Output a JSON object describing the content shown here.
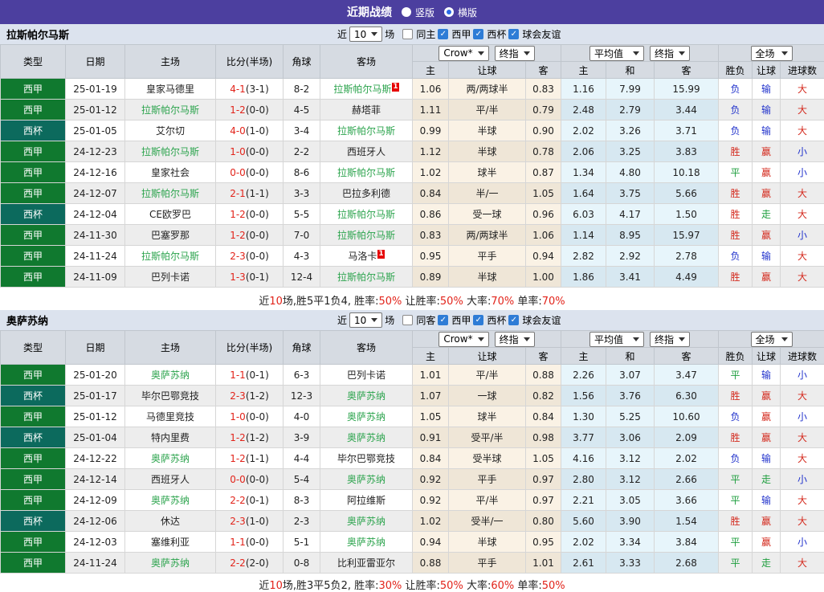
{
  "topbar": {
    "title": "近期战绩",
    "radio_vertical": "竖版",
    "radio_horizontal": "横版",
    "selected_mode": "横版"
  },
  "filters_common": {
    "near_label": "近",
    "near_value": "10",
    "games_label": "场",
    "league1": "西甲",
    "league2": "西杯",
    "league3": "球会友谊"
  },
  "table_header": {
    "type": "类型",
    "date": "日期",
    "home": "主场",
    "score": "比分(半场)",
    "corner": "角球",
    "away": "客场",
    "dd_crow": "Crow*",
    "dd_final1": "终指",
    "dd_avg": "平均值",
    "dd_final2": "终指",
    "dd_full": "全场",
    "h_home": "主",
    "h_handicap": "让球",
    "h_away": "客",
    "a_home": "主",
    "a_draw": "和",
    "a_away": "客",
    "r_wdl": "胜负",
    "r_handicap": "让球",
    "r_goals": "进球数"
  },
  "colors": {
    "topbar_purple": "#4c3f9f",
    "liga_green": "#10792f",
    "cup_teal": "#0c6a5d",
    "self_team_green": "#2da44e",
    "score_red": "#e2241b",
    "win_red": "#d42a1e",
    "lose_blue": "#2233cc",
    "draw_green": "#1e9e3e"
  },
  "sections": [
    {
      "team": "拉斯帕尔马斯",
      "same_label": "同主",
      "rows": [
        {
          "league": "西甲",
          "date": "25-01-19",
          "home": {
            "name": "皇家马德里",
            "self": false,
            "red": 0
          },
          "score_ft": "4-1",
          "score_ht": "(3-1)",
          "corner": "8-2",
          "away": {
            "name": "拉斯帕尔马斯",
            "self": true,
            "red": 1
          },
          "odds": [
            "1.06",
            "两/两球半",
            "0.83",
            "1.16",
            "7.99",
            "15.99"
          ],
          "results": [
            "负",
            "输",
            "大"
          ]
        },
        {
          "league": "西甲",
          "date": "25-01-12",
          "home": {
            "name": "拉斯帕尔马斯",
            "self": true,
            "red": 0
          },
          "score_ft": "1-2",
          "score_ht": "(0-0)",
          "corner": "4-5",
          "away": {
            "name": "赫塔菲",
            "self": false,
            "red": 0
          },
          "odds": [
            "1.11",
            "平/半",
            "0.79",
            "2.48",
            "2.79",
            "3.44"
          ],
          "results": [
            "负",
            "输",
            "大"
          ]
        },
        {
          "league": "西杯",
          "date": "25-01-05",
          "home": {
            "name": "艾尔切",
            "self": false,
            "red": 0
          },
          "score_ft": "4-0",
          "score_ht": "(1-0)",
          "corner": "3-4",
          "away": {
            "name": "拉斯帕尔马斯",
            "self": true,
            "red": 0
          },
          "odds": [
            "0.99",
            "半球",
            "0.90",
            "2.02",
            "3.26",
            "3.71"
          ],
          "results": [
            "负",
            "输",
            "大"
          ]
        },
        {
          "league": "西甲",
          "date": "24-12-23",
          "home": {
            "name": "拉斯帕尔马斯",
            "self": true,
            "red": 0
          },
          "score_ft": "1-0",
          "score_ht": "(0-0)",
          "corner": "2-2",
          "away": {
            "name": "西班牙人",
            "self": false,
            "red": 0
          },
          "odds": [
            "1.12",
            "半球",
            "0.78",
            "2.06",
            "3.25",
            "3.83"
          ],
          "results": [
            "胜",
            "赢",
            "小"
          ]
        },
        {
          "league": "西甲",
          "date": "24-12-16",
          "home": {
            "name": "皇家社会",
            "self": false,
            "red": 0
          },
          "score_ft": "0-0",
          "score_ht": "(0-0)",
          "corner": "8-6",
          "away": {
            "name": "拉斯帕尔马斯",
            "self": true,
            "red": 0
          },
          "odds": [
            "1.02",
            "球半",
            "0.87",
            "1.34",
            "4.80",
            "10.18"
          ],
          "results": [
            "平",
            "赢",
            "小"
          ]
        },
        {
          "league": "西甲",
          "date": "24-12-07",
          "home": {
            "name": "拉斯帕尔马斯",
            "self": true,
            "red": 0
          },
          "score_ft": "2-1",
          "score_ht": "(1-1)",
          "corner": "3-3",
          "away": {
            "name": "巴拉多利德",
            "self": false,
            "red": 0
          },
          "odds": [
            "0.84",
            "半/一",
            "1.05",
            "1.64",
            "3.75",
            "5.66"
          ],
          "results": [
            "胜",
            "赢",
            "大"
          ]
        },
        {
          "league": "西杯",
          "date": "24-12-04",
          "home": {
            "name": "CE欧罗巴",
            "self": false,
            "red": 0
          },
          "score_ft": "1-2",
          "score_ht": "(0-0)",
          "corner": "5-5",
          "away": {
            "name": "拉斯帕尔马斯",
            "self": true,
            "red": 0
          },
          "odds": [
            "0.86",
            "受一球",
            "0.96",
            "6.03",
            "4.17",
            "1.50"
          ],
          "results": [
            "胜",
            "走",
            "大"
          ]
        },
        {
          "league": "西甲",
          "date": "24-11-30",
          "home": {
            "name": "巴塞罗那",
            "self": false,
            "red": 0
          },
          "score_ft": "1-2",
          "score_ht": "(0-0)",
          "corner": "7-0",
          "away": {
            "name": "拉斯帕尔马斯",
            "self": true,
            "red": 0
          },
          "odds": [
            "0.83",
            "两/两球半",
            "1.06",
            "1.14",
            "8.95",
            "15.97"
          ],
          "results": [
            "胜",
            "赢",
            "小"
          ]
        },
        {
          "league": "西甲",
          "date": "24-11-24",
          "home": {
            "name": "拉斯帕尔马斯",
            "self": true,
            "red": 0
          },
          "score_ft": "2-3",
          "score_ht": "(0-0)",
          "corner": "4-3",
          "away": {
            "name": "马洛卡",
            "self": false,
            "red": 1
          },
          "odds": [
            "0.95",
            "平手",
            "0.94",
            "2.82",
            "2.92",
            "2.78"
          ],
          "results": [
            "负",
            "输",
            "大"
          ]
        },
        {
          "league": "西甲",
          "date": "24-11-09",
          "home": {
            "name": "巴列卡诺",
            "self": false,
            "red": 0
          },
          "score_ft": "1-3",
          "score_ht": "(0-1)",
          "corner": "12-4",
          "away": {
            "name": "拉斯帕尔马斯",
            "self": true,
            "red": 0
          },
          "odds": [
            "0.89",
            "半球",
            "1.00",
            "1.86",
            "3.41",
            "4.49"
          ],
          "results": [
            "胜",
            "赢",
            "大"
          ]
        }
      ],
      "summary": [
        [
          "近",
          "k"
        ],
        [
          "10",
          "r"
        ],
        [
          "场,胜5平1负4, 胜率:",
          "k"
        ],
        [
          "50%",
          "r"
        ],
        [
          " 让胜率:",
          "k"
        ],
        [
          "50%",
          "r"
        ],
        [
          " 大率:",
          "k"
        ],
        [
          "70%",
          "r"
        ],
        [
          " 单率:",
          "k"
        ],
        [
          "70%",
          "r"
        ]
      ]
    },
    {
      "team": "奥萨苏纳",
      "same_label": "同客",
      "rows": [
        {
          "league": "西甲",
          "date": "25-01-20",
          "home": {
            "name": "奥萨苏纳",
            "self": true,
            "red": 0
          },
          "score_ft": "1-1",
          "score_ht": "(0-1)",
          "corner": "6-3",
          "away": {
            "name": "巴列卡诺",
            "self": false,
            "red": 0
          },
          "odds": [
            "1.01",
            "平/半",
            "0.88",
            "2.26",
            "3.07",
            "3.47"
          ],
          "results": [
            "平",
            "输",
            "小"
          ]
        },
        {
          "league": "西杯",
          "date": "25-01-17",
          "home": {
            "name": "毕尔巴鄂竞技",
            "self": false,
            "red": 0
          },
          "score_ft": "2-3",
          "score_ht": "(1-2)",
          "corner": "12-3",
          "away": {
            "name": "奥萨苏纳",
            "self": true,
            "red": 0
          },
          "odds": [
            "1.07",
            "一球",
            "0.82",
            "1.56",
            "3.76",
            "6.30"
          ],
          "results": [
            "胜",
            "赢",
            "大"
          ]
        },
        {
          "league": "西甲",
          "date": "25-01-12",
          "home": {
            "name": "马德里竞技",
            "self": false,
            "red": 0
          },
          "score_ft": "1-0",
          "score_ht": "(0-0)",
          "corner": "4-0",
          "away": {
            "name": "奥萨苏纳",
            "self": true,
            "red": 0
          },
          "odds": [
            "1.05",
            "球半",
            "0.84",
            "1.30",
            "5.25",
            "10.60"
          ],
          "results": [
            "负",
            "赢",
            "小"
          ]
        },
        {
          "league": "西杯",
          "date": "25-01-04",
          "home": {
            "name": "特内里费",
            "self": false,
            "red": 0
          },
          "score_ft": "1-2",
          "score_ht": "(1-2)",
          "corner": "3-9",
          "away": {
            "name": "奥萨苏纳",
            "self": true,
            "red": 0
          },
          "odds": [
            "0.91",
            "受平/半",
            "0.98",
            "3.77",
            "3.06",
            "2.09"
          ],
          "results": [
            "胜",
            "赢",
            "大"
          ]
        },
        {
          "league": "西甲",
          "date": "24-12-22",
          "home": {
            "name": "奥萨苏纳",
            "self": true,
            "red": 0
          },
          "score_ft": "1-2",
          "score_ht": "(1-1)",
          "corner": "4-4",
          "away": {
            "name": "毕尔巴鄂竞技",
            "self": false,
            "red": 0
          },
          "odds": [
            "0.84",
            "受半球",
            "1.05",
            "4.16",
            "3.12",
            "2.02"
          ],
          "results": [
            "负",
            "输",
            "大"
          ]
        },
        {
          "league": "西甲",
          "date": "24-12-14",
          "home": {
            "name": "西班牙人",
            "self": false,
            "red": 0
          },
          "score_ft": "0-0",
          "score_ht": "(0-0)",
          "corner": "5-4",
          "away": {
            "name": "奥萨苏纳",
            "self": true,
            "red": 0
          },
          "odds": [
            "0.92",
            "平手",
            "0.97",
            "2.80",
            "3.12",
            "2.66"
          ],
          "results": [
            "平",
            "走",
            "小"
          ]
        },
        {
          "league": "西甲",
          "date": "24-12-09",
          "home": {
            "name": "奥萨苏纳",
            "self": true,
            "red": 0
          },
          "score_ft": "2-2",
          "score_ht": "(0-1)",
          "corner": "8-3",
          "away": {
            "name": "阿拉维斯",
            "self": false,
            "red": 0
          },
          "odds": [
            "0.92",
            "平/半",
            "0.97",
            "2.21",
            "3.05",
            "3.66"
          ],
          "results": [
            "平",
            "输",
            "大"
          ]
        },
        {
          "league": "西杯",
          "date": "24-12-06",
          "home": {
            "name": "休达",
            "self": false,
            "red": 0
          },
          "score_ft": "2-3",
          "score_ht": "(1-0)",
          "corner": "2-3",
          "away": {
            "name": "奥萨苏纳",
            "self": true,
            "red": 0
          },
          "odds": [
            "1.02",
            "受半/一",
            "0.80",
            "5.60",
            "3.90",
            "1.54"
          ],
          "results": [
            "胜",
            "赢",
            "大"
          ]
        },
        {
          "league": "西甲",
          "date": "24-12-03",
          "home": {
            "name": "塞维利亚",
            "self": false,
            "red": 0
          },
          "score_ft": "1-1",
          "score_ht": "(0-0)",
          "corner": "5-1",
          "away": {
            "name": "奥萨苏纳",
            "self": true,
            "red": 0
          },
          "odds": [
            "0.94",
            "半球",
            "0.95",
            "2.02",
            "3.34",
            "3.84"
          ],
          "results": [
            "平",
            "赢",
            "小"
          ]
        },
        {
          "league": "西甲",
          "date": "24-11-24",
          "home": {
            "name": "奥萨苏纳",
            "self": true,
            "red": 0
          },
          "score_ft": "2-2",
          "score_ht": "(2-0)",
          "corner": "0-8",
          "away": {
            "name": "比利亚雷亚尔",
            "self": false,
            "red": 0
          },
          "odds": [
            "0.88",
            "平手",
            "1.01",
            "2.61",
            "3.33",
            "2.68"
          ],
          "results": [
            "平",
            "走",
            "大"
          ]
        }
      ],
      "summary": [
        [
          "近",
          "k"
        ],
        [
          "10",
          "r"
        ],
        [
          "场,胜3平5负2, 胜率:",
          "k"
        ],
        [
          "30%",
          "r"
        ],
        [
          " 让胜率:",
          "k"
        ],
        [
          "50%",
          "r"
        ],
        [
          " 大率:",
          "k"
        ],
        [
          "60%",
          "r"
        ],
        [
          " 单率:",
          "k"
        ],
        [
          "50%",
          "r"
        ]
      ]
    }
  ]
}
